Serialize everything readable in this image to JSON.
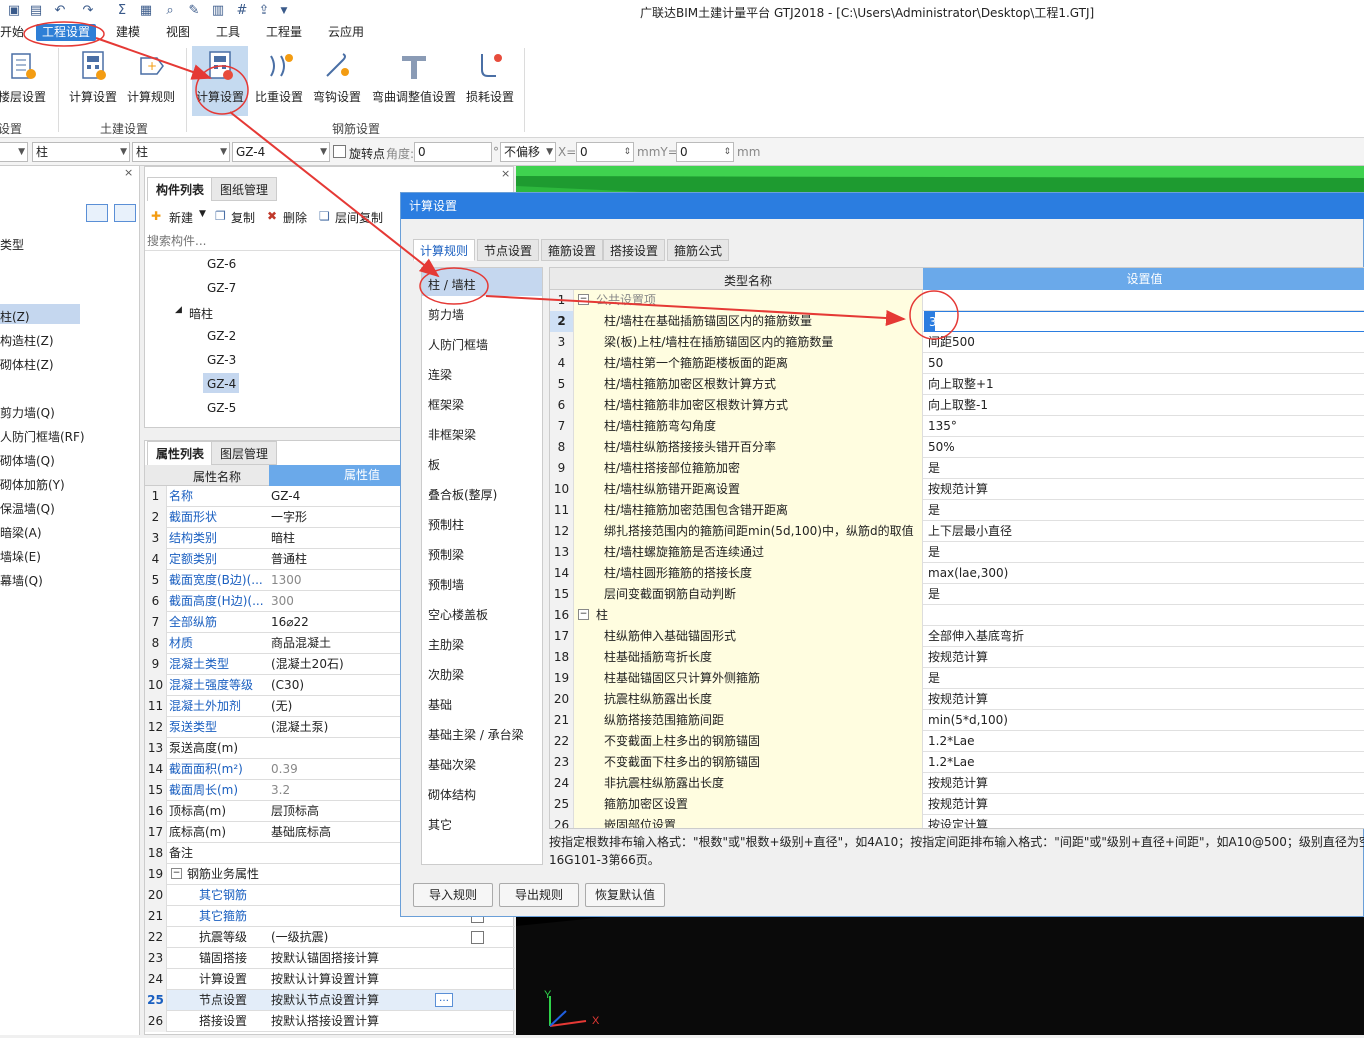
{
  "window": {
    "title": "广联达BIM土建计量平台 GTJ2018 - [C:\\Users\\Administrator\\Desktop\\工程1.GTJ]"
  },
  "menu": [
    "开始",
    "工程设置",
    "建模",
    "视图",
    "工具",
    "工程量",
    "云应用"
  ],
  "ribbon": {
    "buttons": [
      "楼层设置",
      "计算设置",
      "计算规则",
      "计算设置",
      "比重设置",
      "弯钩设置",
      "弯曲调整值设置",
      "损耗设置"
    ],
    "groups": [
      "设置",
      "土建设置",
      "钢筋设置"
    ]
  },
  "propbar": {
    "combo1": "柱",
    "combo2": "柱",
    "combo3": "GZ-4",
    "rotate_label": "旋转点",
    "angle_label": "角度:",
    "angle_value": "0",
    "deg": "°",
    "offset": "不偏移",
    "x_label": "X=",
    "x_value": "0",
    "mm1": "mmY=",
    "y_value": "0",
    "mm2": "mm"
  },
  "left_panel": {
    "items": [
      "类型",
      "柱(Z)",
      "构造柱(Z)",
      "砌体柱(Z)",
      "剪力墙(Q)",
      "人防门框墙(RF)",
      "砌体墙(Q)",
      "砌体加筋(Y)",
      "保温墙(Q)",
      "暗梁(A)",
      "墙垛(E)",
      "幕墙(Q)"
    ]
  },
  "component_list": {
    "tabs": [
      "构件列表",
      "图纸管理"
    ],
    "toolbar": [
      "新建",
      "复制",
      "删除",
      "层间复制"
    ],
    "search_placeholder": "搜索构件...",
    "tree": [
      "GZ-6",
      "GZ-7",
      "暗柱",
      "GZ-2",
      "GZ-3",
      "GZ-4",
      "GZ-5"
    ]
  },
  "property_list": {
    "tabs": [
      "属性列表",
      "图层管理"
    ],
    "headers": [
      "属性名称",
      "属性值"
    ],
    "rows": [
      [
        "1",
        "名称",
        "GZ-4"
      ],
      [
        "2",
        "截面形状",
        "一字形"
      ],
      [
        "3",
        "结构类别",
        "暗柱"
      ],
      [
        "4",
        "定额类别",
        "普通柱"
      ],
      [
        "5",
        "截面宽度(B边)(...",
        "1300"
      ],
      [
        "6",
        "截面高度(H边)(...",
        "300"
      ],
      [
        "7",
        "全部纵筋",
        "16⌀22"
      ],
      [
        "8",
        "材质",
        "商品混凝土"
      ],
      [
        "9",
        "混凝土类型",
        "(混凝土20石)"
      ],
      [
        "10",
        "混凝土强度等级",
        "(C30)"
      ],
      [
        "11",
        "混凝土外加剂",
        "(无)"
      ],
      [
        "12",
        "泵送类型",
        "(混凝土泵)"
      ],
      [
        "13",
        "泵送高度(m)",
        ""
      ],
      [
        "14",
        "截面面积(m²)",
        "0.39"
      ],
      [
        "15",
        "截面周长(m)",
        "3.2"
      ],
      [
        "16",
        "顶标高(m)",
        "层顶标高"
      ],
      [
        "17",
        "底标高(m)",
        "基础底标高"
      ],
      [
        "18",
        "备注",
        ""
      ],
      [
        "19",
        "钢筋业务属性",
        ""
      ],
      [
        "20",
        "其它钢筋",
        ""
      ],
      [
        "21",
        "其它箍筋",
        ""
      ],
      [
        "22",
        "抗震等级",
        "(一级抗震)"
      ],
      [
        "23",
        "锚固搭接",
        "按默认锚固搭接计算"
      ],
      [
        "24",
        "计算设置",
        "按默认计算设置计算"
      ],
      [
        "25",
        "节点设置",
        "按默认节点设置计算"
      ],
      [
        "26",
        "搭接设置",
        "按默认搭接设置计算"
      ]
    ]
  },
  "dialog": {
    "title": "计算设置",
    "tabs": [
      "计算规则",
      "节点设置",
      "箍筋设置",
      "搭接设置",
      "箍筋公式"
    ],
    "categories": [
      "柱 / 墙柱",
      "剪力墙",
      "人防门框墙",
      "连梁",
      "框架梁",
      "非框架梁",
      "板",
      "叠合板(整厚)",
      "预制柱",
      "预制梁",
      "预制墙",
      "空心楼盖板",
      "主肋梁",
      "次肋梁",
      "基础",
      "基础主梁 / 承台梁",
      "基础次梁",
      "砌体结构",
      "其它"
    ],
    "grid_headers": [
      "类型名称",
      "设置值"
    ],
    "rows": [
      [
        "1",
        "公共设置项",
        ""
      ],
      [
        "2",
        "柱/墙柱在基础插筋锚固区内的箍筋数量",
        "3"
      ],
      [
        "3",
        "梁(板)上柱/墙柱在插筋锚固区内的箍筋数量",
        "间距500"
      ],
      [
        "4",
        "柱/墙柱第一个箍筋距楼板面的距离",
        "50"
      ],
      [
        "5",
        "柱/墙柱箍筋加密区根数计算方式",
        "向上取整+1"
      ],
      [
        "6",
        "柱/墙柱箍筋非加密区根数计算方式",
        "向上取整-1"
      ],
      [
        "7",
        "柱/墙柱箍筋弯勾角度",
        "135°"
      ],
      [
        "8",
        "柱/墙柱纵筋搭接接头错开百分率",
        "50%"
      ],
      [
        "9",
        "柱/墙柱搭接部位箍筋加密",
        "是"
      ],
      [
        "10",
        "柱/墙柱纵筋错开距离设置",
        "按规范计算"
      ],
      [
        "11",
        "柱/墙柱箍筋加密范围包含错开距离",
        "是"
      ],
      [
        "12",
        "绑扎搭接范围内的箍筋间距min(5d,100)中，纵筋d的取值",
        "上下层最小直径"
      ],
      [
        "13",
        "柱/墙柱螺旋箍筋是否连续通过",
        "是"
      ],
      [
        "14",
        "柱/墙柱圆形箍筋的搭接长度",
        "max(lae,300)"
      ],
      [
        "15",
        "层间变截面钢筋自动判断",
        "是"
      ],
      [
        "16",
        "柱",
        ""
      ],
      [
        "17",
        "柱纵筋伸入基础锚固形式",
        "全部伸入基底弯折"
      ],
      [
        "18",
        "柱基础插筋弯折长度",
        "按规范计算"
      ],
      [
        "19",
        "柱基础锚固区只计算外侧箍筋",
        "是"
      ],
      [
        "20",
        "抗震柱纵筋露出长度",
        "按规范计算"
      ],
      [
        "21",
        "纵筋搭接范围箍筋间距",
        "min(5*d,100)"
      ],
      [
        "22",
        "不变截面上柱多出的钢筋锚固",
        "1.2*Lae"
      ],
      [
        "23",
        "不变截面下柱多出的钢筋锚固",
        "1.2*Lae"
      ],
      [
        "24",
        "非抗震柱纵筋露出长度",
        "按规范计算"
      ],
      [
        "25",
        "箍筋加密区设置",
        "按规范计算"
      ],
      [
        "26",
        "嵌固部位设置",
        "按设定计算"
      ]
    ],
    "note_line1": "按指定根数排布输入格式：\"根数\"或\"根数+级别+直径\"，如4A10；按指定间距排布输入格式：\"间距\"或\"级别+直径+间距\"，如A10@500；级别直径为空时",
    "note_line2": "16G101-3第66页。",
    "buttons": [
      "导入规则",
      "导出规则",
      "恢复默认值"
    ]
  },
  "colors": {
    "accent": "#2b7de0",
    "annotation": "#e53935",
    "name_cell_bg": "#fffde0",
    "canvas_green": "#2db83d"
  }
}
